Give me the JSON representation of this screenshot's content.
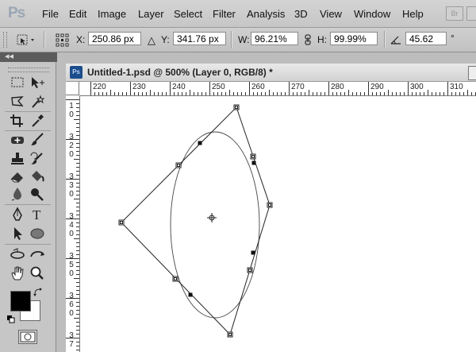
{
  "app": {
    "logo": "Ps"
  },
  "menu": [
    "File",
    "Edit",
    "Image",
    "Layer",
    "Select",
    "Filter",
    "Analysis",
    "3D",
    "View",
    "Window",
    "Help"
  ],
  "menubar_extra": {
    "bridge_label": "Br"
  },
  "options": {
    "x_label": "X:",
    "x_value": "250.86 px",
    "y_label": "Y:",
    "y_value": "341.76 px",
    "w_label": "W:",
    "w_value": "96.21%",
    "h_label": "H:",
    "h_value": "99.99%",
    "angle_value": "45.62",
    "angle_unit": "°"
  },
  "tools_panel": {
    "collapse_glyph": "◂◂"
  },
  "document": {
    "icon_text": "Ps",
    "title": "Untitled-1.psd @ 500% (Layer 0, RGB/8) *"
  },
  "ruler": {
    "horizontal": [
      "220",
      "230",
      "240",
      "250",
      "260",
      "270",
      "280",
      "290",
      "300",
      "310"
    ],
    "vertical": [
      [
        "1",
        "0"
      ],
      [
        "3",
        "2",
        "0"
      ],
      [
        "3",
        "3",
        "0"
      ],
      [
        "3",
        "4",
        "0"
      ],
      [
        "3",
        "5",
        "0"
      ],
      [
        "3",
        "6",
        "0"
      ],
      [
        "3",
        "7"
      ]
    ]
  },
  "colors": {
    "foreground": "#000000",
    "background": "#ffffff",
    "doc_icon": "#1c4d8c"
  }
}
